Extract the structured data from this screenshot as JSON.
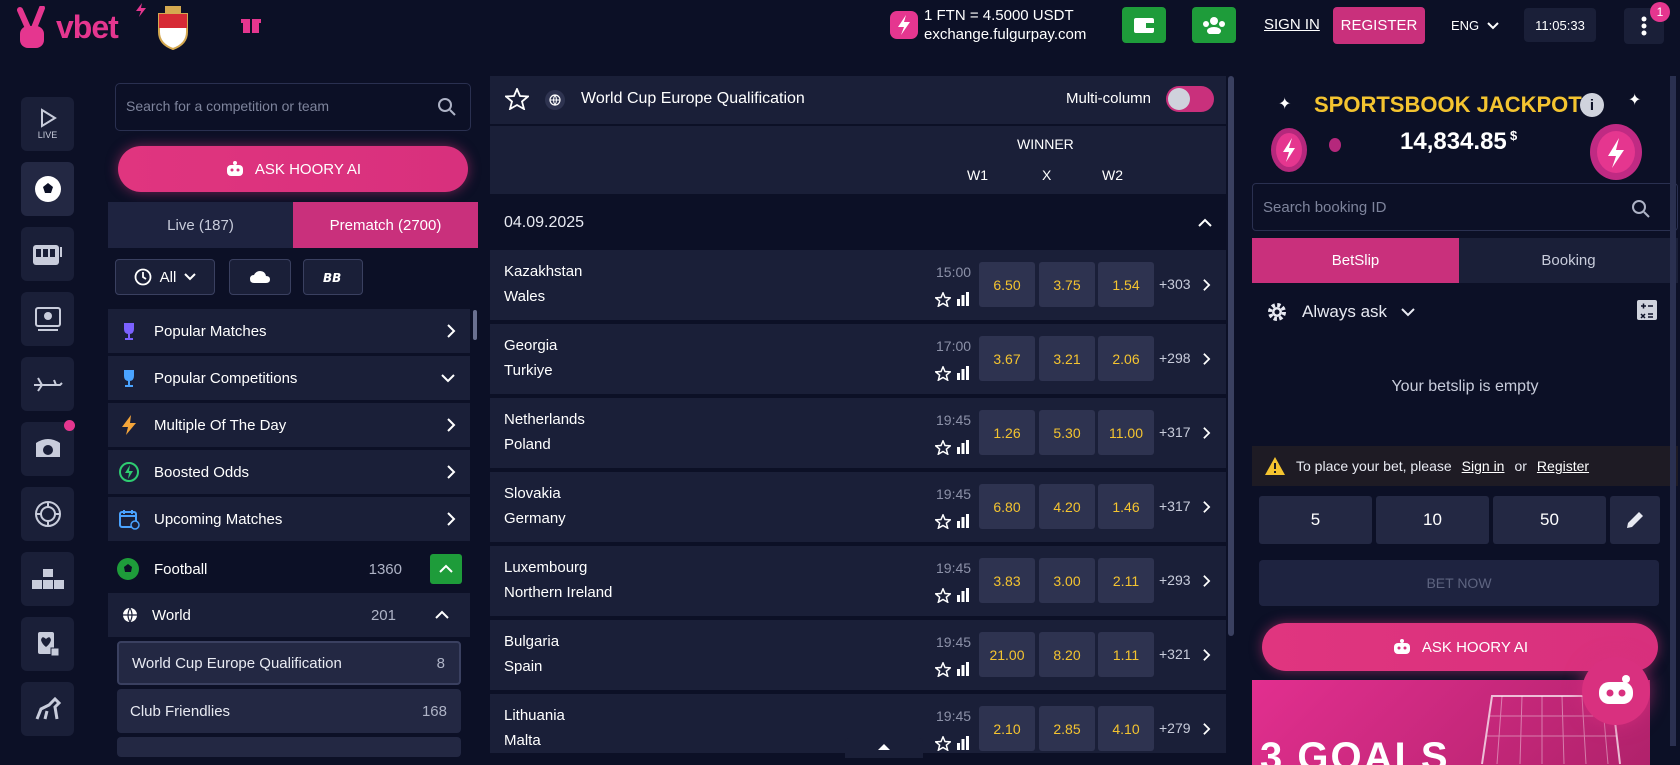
{
  "header": {
    "logo": "vbet",
    "fx_rate": "1 FTN = 4.5000 USDT",
    "fx_site": "exchange.fulgurpay.com",
    "sign_in": "SIGN IN",
    "register": "REGISTER",
    "language": "ENG",
    "clock": "11:05:33",
    "notifications": "1"
  },
  "rail": {
    "live_label": "LIVE"
  },
  "left": {
    "search_placeholder": "Search for a competition or team",
    "ask_ai": "ASK HOORY AI",
    "tabs": {
      "live": "Live (187)",
      "prematch": "Prematch (2700)"
    },
    "filter_all": "All",
    "nav": [
      {
        "label": "Popular Matches"
      },
      {
        "label": "Popular Competitions"
      },
      {
        "label": "Multiple Of The Day"
      },
      {
        "label": "Boosted Odds"
      },
      {
        "label": "Upcoming Matches"
      }
    ],
    "sport": {
      "label": "Football",
      "count": "1360"
    },
    "region": {
      "label": "World",
      "count": "201"
    },
    "competitions": [
      {
        "label": "World Cup Europe Qualification",
        "count": "8"
      },
      {
        "label": "Club Friendlies",
        "count": "168"
      }
    ]
  },
  "center": {
    "competition_title": "World Cup Europe Qualification",
    "multi_column": "Multi-column",
    "market": "WINNER",
    "cols": [
      "W1",
      "X",
      "W2"
    ],
    "date": "04.09.2025",
    "matches": [
      {
        "home": "Kazakhstan",
        "away": "Wales",
        "time": "15:00",
        "w1": "6.50",
        "x": "3.75",
        "w2": "1.54",
        "more": "+303"
      },
      {
        "home": "Georgia",
        "away": "Turkiye",
        "time": "17:00",
        "w1": "3.67",
        "x": "3.21",
        "w2": "2.06",
        "more": "+298"
      },
      {
        "home": "Netherlands",
        "away": "Poland",
        "time": "19:45",
        "w1": "1.26",
        "x": "5.30",
        "w2": "11.00",
        "more": "+317"
      },
      {
        "home": "Slovakia",
        "away": "Germany",
        "time": "19:45",
        "w1": "6.80",
        "x": "4.20",
        "w2": "1.46",
        "more": "+317"
      },
      {
        "home": "Luxembourg",
        "away": "Northern Ireland",
        "time": "19:45",
        "w1": "3.83",
        "x": "3.00",
        "w2": "2.11",
        "more": "+293"
      },
      {
        "home": "Bulgaria",
        "away": "Spain",
        "time": "19:45",
        "w1": "21.00",
        "x": "8.20",
        "w2": "1.11",
        "more": "+321"
      },
      {
        "home": "Lithuania",
        "away": "Malta",
        "time": "19:45",
        "w1": "2.10",
        "x": "2.85",
        "w2": "4.10",
        "more": "+279"
      }
    ]
  },
  "right": {
    "jackpot_title": "SPORTSBOOK JACKPOT",
    "jackpot_value": "14,834.85",
    "jackpot_currency": "$",
    "search_booking_placeholder": "Search booking ID",
    "tab_betslip": "BetSlip",
    "tab_booking": "Booking",
    "always_ask": "Always ask",
    "empty": "Your betslip is empty",
    "warn_prefix": "To place your bet, please",
    "warn_signin": "Sign in",
    "warn_or": "or",
    "warn_register": "Register",
    "stakes": [
      "5",
      "10",
      "50"
    ],
    "bet_now": "BET NOW",
    "ask_ai": "ASK HOORY AI",
    "promo": "3 GOALS"
  },
  "colors": {
    "accent": "#c9307c",
    "bg": "#0c1026",
    "panel": "#1a1f38",
    "odds": "#f4c430",
    "green": "#1e9c3a"
  }
}
